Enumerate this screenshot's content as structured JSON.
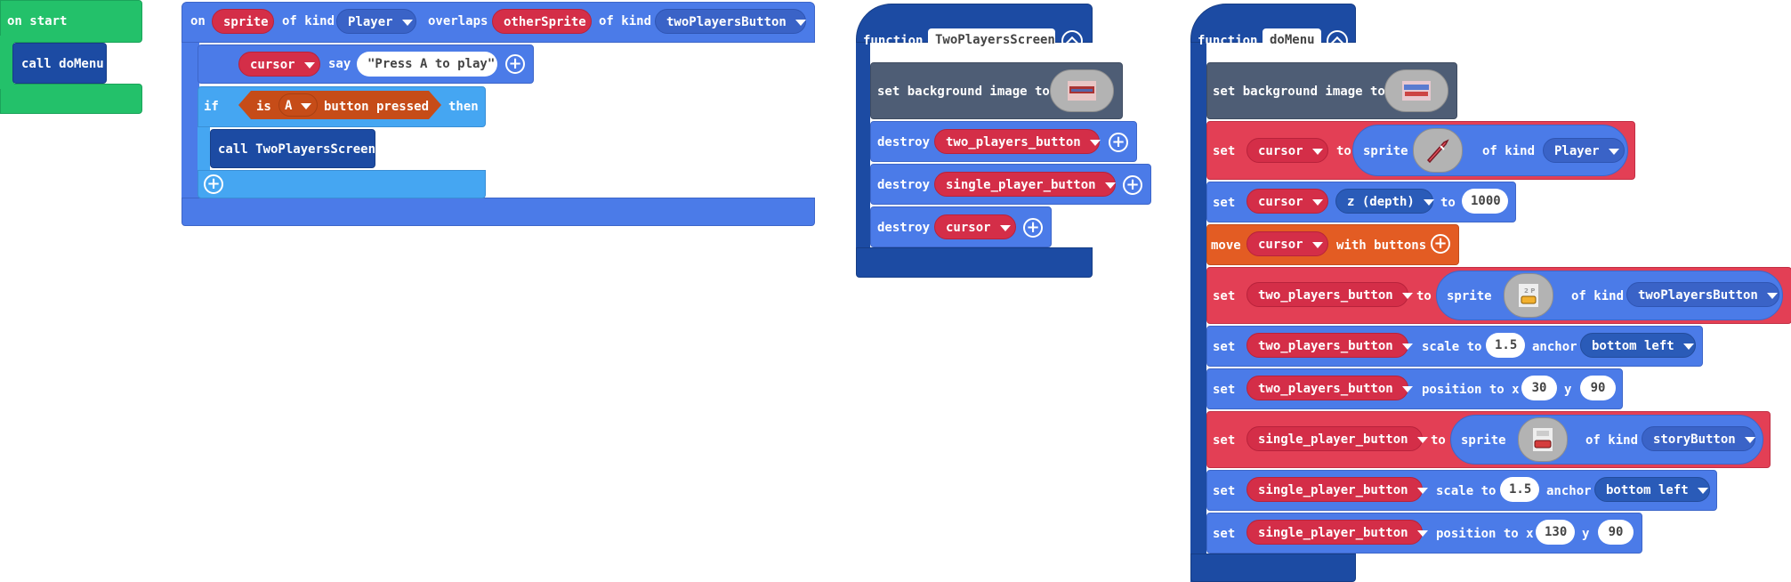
{
  "on_start": {
    "label": "on start",
    "call_label": "call doMenu"
  },
  "overlap_event": {
    "on": "on",
    "sprite": "sprite",
    "of_kind_1": "of kind",
    "kind1": "Player",
    "overlaps": "overlaps",
    "other": "otherSprite",
    "of_kind_2": "of kind",
    "kind2": "twoPlayersButton",
    "say_sprite": "cursor",
    "say": "say",
    "say_text": "\"Press A to play\"",
    "if": "if",
    "is": "is",
    "button": "A",
    "pressed": "button pressed",
    "then": "then",
    "call": "call TwoPlayersScreen"
  },
  "two_players_fn": {
    "function": "function",
    "name": "TwoPlayersScreen",
    "set_bg": "set background image to",
    "destroy": "destroy",
    "destroy1": "two_players_button",
    "destroy2": "single_player_button",
    "destroy3": "cursor"
  },
  "do_menu_fn": {
    "function": "function",
    "name": "doMenu",
    "set_bg": "set background image to",
    "set": "set",
    "to": "to",
    "sprite": "sprite",
    "of_kind": "of kind",
    "cursor": "cursor",
    "kind_player": "Player",
    "depth": "z (depth)",
    "depth_val": "1000",
    "move": "move",
    "with_buttons": "with buttons",
    "two_btn": "two_players_button",
    "kind_two": "twoPlayersButton",
    "scale_to": "scale to",
    "scale_val": "1.5",
    "anchor": "anchor",
    "anchor_val": "bottom left",
    "position_to_x": "position to x",
    "y": "y",
    "two_x": "30",
    "two_y": "90",
    "single_btn": "single_player_button",
    "kind_story": "storyButton",
    "single_x": "130",
    "single_y": "90"
  }
}
